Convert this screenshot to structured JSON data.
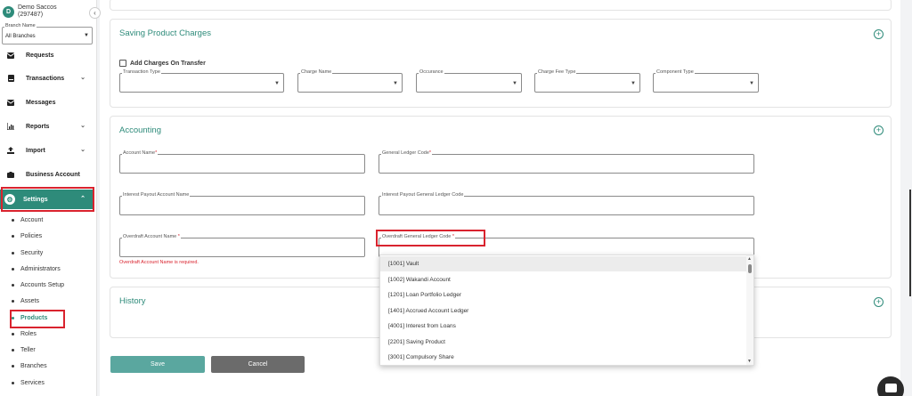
{
  "org": {
    "initial": "D",
    "name": "Demo Saccos",
    "code": "(297487)"
  },
  "branch": {
    "label": "Branch Name",
    "value": "All Branches"
  },
  "nav": {
    "requests": "Requests",
    "transactions": "Transactions",
    "messages": "Messages",
    "reports": "Reports",
    "import": "Import",
    "business_account": "Business Account",
    "settings": "Settings"
  },
  "settings_sub": [
    "Account",
    "Policies",
    "Security",
    "Administrators",
    "Accounts Setup",
    "Assets",
    "Products",
    "Roles",
    "Teller",
    "Branches",
    "Services"
  ],
  "charges": {
    "title": "Saving Product Charges",
    "checkbox_label": "Add Charges On Transfer",
    "fields": [
      "Transaction Type",
      "Charge Name",
      "Occurance",
      "Charge Fee Type",
      "Component Type"
    ]
  },
  "accounting": {
    "title": "Accounting",
    "account_name": "Account Name",
    "gl_code": "General Ledger Code",
    "interest_payout_name": "Interest Payout Account Name",
    "interest_payout_gl": "Interest Payout General Ledger Code",
    "overdraft_name": "Overdraft Account Name ",
    "overdraft_gl": "Overdraft General Ledger Code ",
    "required_mark": "*",
    "overdraft_error": "Overdraft Account Name is required."
  },
  "dropdown_options": [
    "[1001] Vault",
    "[1002] Wakandi Account",
    "[1201] Loan Portfolio Ledger",
    "[1401] Accrued Account Ledger",
    "[4001] Interest from Loans",
    "[2201] Saving Product",
    "[3001] Compulsory Share"
  ],
  "history": {
    "title": "History"
  },
  "buttons": {
    "save": "Save",
    "cancel": "Cancel"
  },
  "colors": {
    "accent": "#2e8b7a",
    "highlight": "#d9232e",
    "save": "#5aa79f",
    "cancel": "#6b6b6b"
  }
}
